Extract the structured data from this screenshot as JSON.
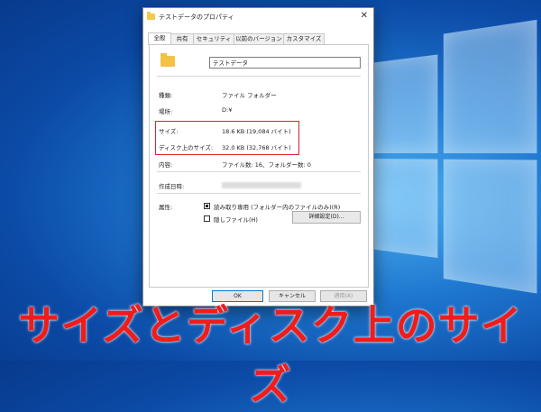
{
  "window": {
    "title": "テストデータのプロパティ",
    "close_glyph": "✕"
  },
  "tabs": [
    {
      "label": "全般"
    },
    {
      "label": "共有"
    },
    {
      "label": "セキュリティ"
    },
    {
      "label": "以前のバージョン"
    },
    {
      "label": "カスタマイズ"
    }
  ],
  "general": {
    "name": "テストデータ",
    "type_label": "種類:",
    "type_value": "ファイル フォルダー",
    "location_label": "場所:",
    "location_value": "D:¥",
    "size_label": "サイズ:",
    "size_value": "18.6 KB (19,084 バイト)",
    "size_on_disk_label": "ディスク上のサイズ:",
    "size_on_disk_value": "32.0 KB (32,768 バイト)",
    "contents_label": "内容:",
    "contents_value": "ファイル数: 16、フォルダー数: 0",
    "created_label": "作成日時:",
    "attributes_label": "属性:",
    "readonly_label": "読み取り専用 (フォルダー内のファイルのみ)(R)",
    "hidden_label": "隠しファイル(H)",
    "advanced_button": "詳細設定(D)..."
  },
  "buttons": {
    "ok": "OK",
    "cancel": "キャンセル",
    "apply": "適用(A)"
  },
  "banner": {
    "text": "サイズとディスク上のサイズ"
  },
  "colors": {
    "highlight": "#e0202b",
    "banner_text": "#ef1c1c",
    "folder": "#f3c242",
    "desktop": "#1f78d0"
  }
}
